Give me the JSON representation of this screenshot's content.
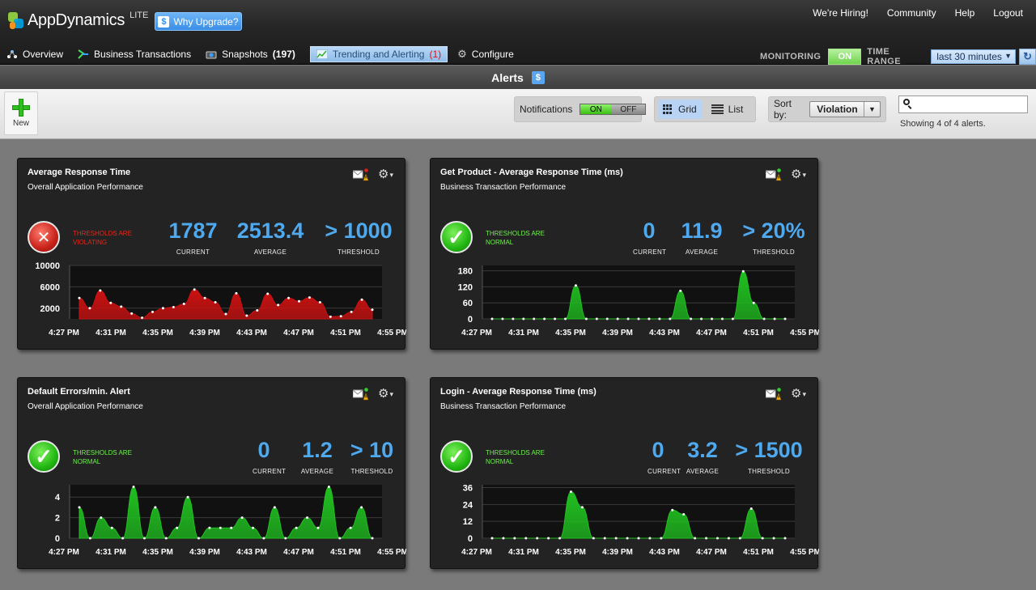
{
  "header": {
    "app_name": "AppDynamics",
    "edition": "LITE",
    "upgrade_label": "Why Upgrade?",
    "links": [
      "We're Hiring!",
      "Community",
      "Help",
      "Logout"
    ]
  },
  "nav": {
    "overview": "Overview",
    "business_transactions": "Business Transactions",
    "snapshots": "Snapshots",
    "snapshots_count": "(197)",
    "trending": "Trending and Alerting",
    "trending_count": "(1)",
    "configure": "Configure"
  },
  "monitoring": {
    "label": "MONITORING",
    "state": "ON"
  },
  "time_range": {
    "label": "TIME RANGE",
    "value": "last 30 minutes",
    "arrow": "▼",
    "refresh": "↻"
  },
  "page": {
    "title": "Alerts"
  },
  "toolbar": {
    "new_label": "New",
    "notifications_label": "Notifications",
    "notif_on": "ON",
    "notif_off": "OFF",
    "grid_label": "Grid",
    "list_label": "List",
    "sort_label": "Sort by:",
    "sort_value": "Violation",
    "search_placeholder": "",
    "showing": "Showing 4 of 4 alerts."
  },
  "cards": [
    {
      "title": "Average Response Time",
      "subtitle": "Overall Application Performance",
      "status": "bad",
      "status_text": "THRESHOLDS ARE VIOLATING",
      "current": "1787",
      "average": "2513.4",
      "threshold": "> 1000",
      "current_label": "CURRENT",
      "average_label": "AVERAGE",
      "threshold_label": "THRESHOLD",
      "color": "#cc1111",
      "yticks": [
        "10000",
        "6000",
        "2000"
      ],
      "ymax": 10000,
      "series": [
        3900,
        2000,
        5300,
        3000,
        2300,
        1000,
        200,
        1300,
        2000,
        2200,
        2800,
        5500,
        3900,
        3100,
        900,
        4800,
        600,
        1600,
        4700,
        2600,
        3900,
        3300,
        4000,
        3100,
        400,
        500,
        1300,
        3600,
        1700
      ],
      "xticks": [
        "4:27 PM",
        "4:31 PM",
        "4:35 PM",
        "4:39 PM",
        "4:43 PM",
        "4:47 PM",
        "4:51 PM",
        "4:55 PM"
      ]
    },
    {
      "title": "Get Product - Average Response Time (ms)",
      "subtitle": "Business Transaction Performance",
      "status": "good",
      "status_text": "THRESHOLDS ARE NORMAL",
      "current": "0",
      "average": "11.9",
      "threshold": "> 20%",
      "current_label": "CURRENT",
      "average_label": "AVERAGE",
      "threshold_label": "THRESHOLD",
      "color": "#20c020",
      "yticks": [
        "180",
        "120",
        "60",
        "0"
      ],
      "ymax": 200,
      "series": [
        0,
        0,
        0,
        0,
        0,
        0,
        0,
        0,
        125,
        0,
        0,
        0,
        0,
        0,
        0,
        0,
        0,
        0,
        105,
        0,
        0,
        0,
        0,
        0,
        178,
        60,
        0,
        0,
        0
      ],
      "xticks": [
        "4:27 PM",
        "4:31 PM",
        "4:35 PM",
        "4:39 PM",
        "4:43 PM",
        "4:47 PM",
        "4:51 PM",
        "4:55 PM"
      ]
    },
    {
      "title": "Default Errors/min. Alert",
      "subtitle": "Overall Application Performance",
      "status": "good",
      "status_text": "THRESHOLDS ARE NORMAL",
      "current": "0",
      "average": "1.2",
      "threshold": "> 10",
      "current_label": "CURRENT",
      "average_label": "AVERAGE",
      "threshold_label": "THRESHOLD",
      "color": "#20c020",
      "yticks": [
        "4",
        "2",
        "0"
      ],
      "ymax": 5.2,
      "series": [
        3,
        0,
        2,
        1,
        0,
        5,
        0,
        3,
        0,
        1,
        4,
        0,
        1,
        1,
        1,
        2,
        1,
        0,
        3,
        0,
        1,
        2,
        1,
        5,
        0,
        1,
        3,
        0
      ],
      "xticks": [
        "4:27 PM",
        "4:31 PM",
        "4:35 PM",
        "4:39 PM",
        "4:43 PM",
        "4:47 PM",
        "4:51 PM",
        "4:55 PM"
      ]
    },
    {
      "title": "Login - Average Response Time (ms)",
      "subtitle": "Business Transaction Performance",
      "status": "good",
      "status_text": "THRESHOLDS ARE NORMAL",
      "current": "0",
      "average": "3.2",
      "threshold": "> 1500",
      "current_label": "CURRENT",
      "average_label": "AVERAGE",
      "threshold_label": "THRESHOLD",
      "color": "#20c020",
      "yticks": [
        "36",
        "24",
        "12",
        "0"
      ],
      "ymax": 38,
      "series": [
        0,
        0,
        0,
        0,
        0,
        0,
        0,
        33,
        22,
        0,
        0,
        0,
        0,
        0,
        0,
        0,
        20,
        17,
        0,
        0,
        0,
        0,
        0,
        21,
        0,
        0,
        0
      ],
      "xticks": [
        "4:27 PM",
        "4:31 PM",
        "4:35 PM",
        "4:39 PM",
        "4:43 PM",
        "4:47 PM",
        "4:51 PM",
        "4:55 PM"
      ]
    }
  ]
}
